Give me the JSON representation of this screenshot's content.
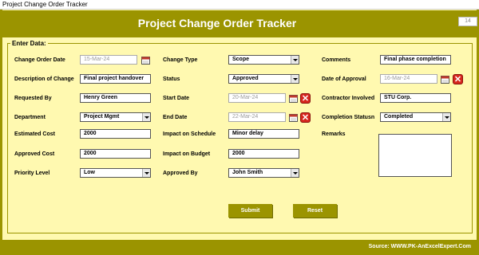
{
  "window": {
    "title": "Project Change Order Tracker"
  },
  "header": {
    "title": "Project Change Order Tracker",
    "counter": "14"
  },
  "form": {
    "group_label": "Enter Data:",
    "change_order_date": {
      "label": "Change Order Date",
      "value": "15-Mar-24"
    },
    "description": {
      "label": "Description of Change",
      "value": "Final project handover"
    },
    "requested_by": {
      "label": "Requested By",
      "value": "Henry Green"
    },
    "department": {
      "label": "Department",
      "value": "Project Mgmt"
    },
    "estimated_cost": {
      "label": "Estimated Cost",
      "value": "2000"
    },
    "approved_cost": {
      "label": "Approved Cost",
      "value": "2000"
    },
    "priority_level": {
      "label": "Priority Level",
      "value": "Low"
    },
    "change_type": {
      "label": "Change Type",
      "value": "Scope"
    },
    "status": {
      "label": "Status",
      "value": "Approved"
    },
    "start_date": {
      "label": "Start Date",
      "value": "20-Mar-24"
    },
    "end_date": {
      "label": "End Date",
      "value": "22-Mar-24"
    },
    "impact_schedule": {
      "label": "Impact on Schedule",
      "value": "Minor delay"
    },
    "impact_budget": {
      "label": "Impact on Budget",
      "value": "2000"
    },
    "approved_by": {
      "label": "Approved By",
      "value": "John Smith"
    },
    "comments": {
      "label": "Comments",
      "value": "Final phase completion"
    },
    "date_of_approval": {
      "label": "Date of Approval",
      "value": "16-Mar-24"
    },
    "contractor": {
      "label": "Contractor Involved",
      "value": "STU Corp."
    },
    "completion_status": {
      "label": "Completion Statusn",
      "value": "Completed"
    },
    "remarks": {
      "label": "Remarks",
      "value": ""
    }
  },
  "buttons": {
    "submit": "Submit",
    "reset": "Reset",
    "clear_glyph": "✕"
  },
  "footer": {
    "source": "Source: WWW.PK-AnExcelExpert.Com"
  },
  "colors": {
    "accent": "#9b9400",
    "background": "#fff9b0",
    "clear_button": "#d7261e"
  },
  "icons": {
    "calendar": "calendar-icon",
    "clear": "close-icon"
  }
}
